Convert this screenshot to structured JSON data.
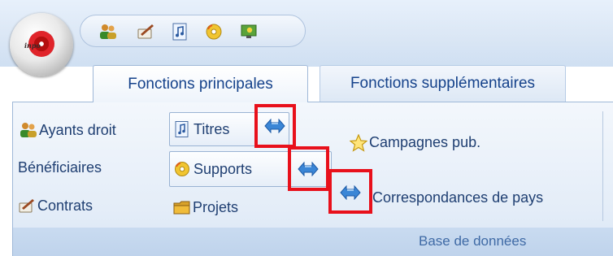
{
  "app": {
    "orb_text": "inpo"
  },
  "quick_access": [
    "people-icon",
    "pen-icon",
    "music-doc-icon",
    "disc-icon",
    "gear-icon"
  ],
  "tabs": [
    {
      "label": "Fonctions principales",
      "active": true
    },
    {
      "label": "Fonctions supplémentaires",
      "active": false
    }
  ],
  "ribbon": {
    "group_label": "Base de données",
    "col1": {
      "ayants_droit": "Ayants droit",
      "beneficiaires": "Bénéficiaires",
      "contrats": "Contrats"
    },
    "col2": {
      "titres": "Titres",
      "supports": "Supports",
      "projets": "Projets"
    },
    "col3": {
      "campagnes": "Campagnes pub.",
      "correspondances": "Correspondances de pays"
    }
  },
  "colors": {
    "highlight": "#e8101b",
    "text": "#1f3f72",
    "tab_text": "#15428b",
    "arrow": "#3b86d6"
  }
}
